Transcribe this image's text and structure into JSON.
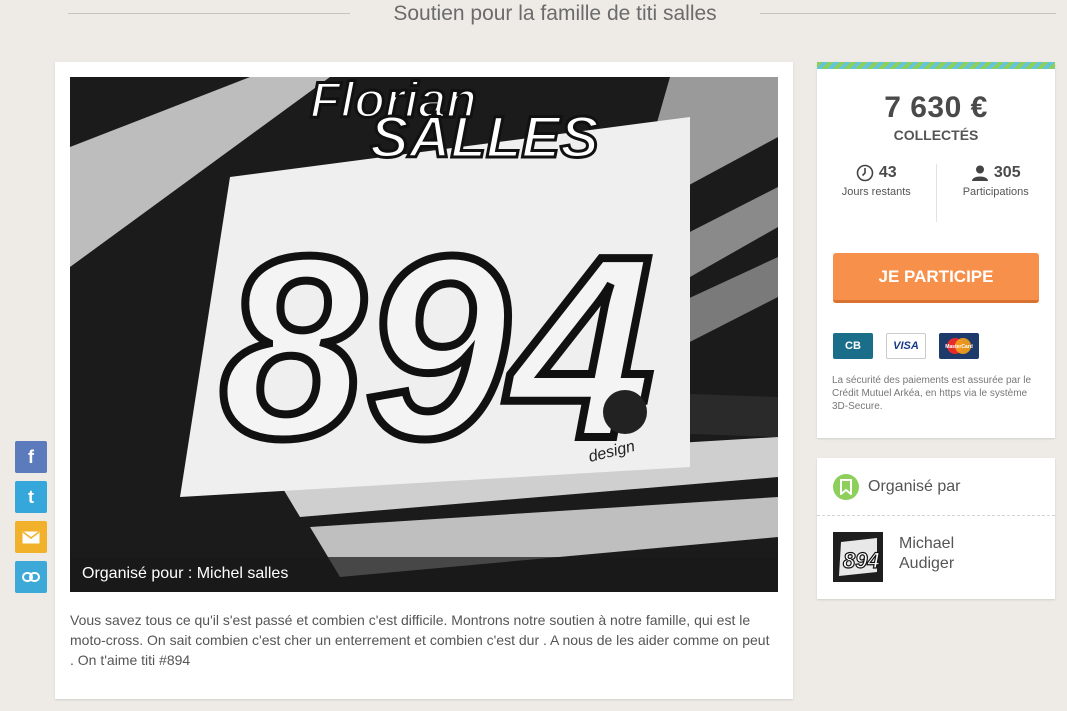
{
  "page": {
    "title": "Soutien pour la famille de titi salles"
  },
  "photo": {
    "caption": "Organisé pour : Michel salles",
    "jersey_name_1": "Florian",
    "jersey_name_2": "SALLES",
    "jersey_number": "894",
    "jersey_brand": "design"
  },
  "description": "Vous savez tous ce qu'il s'est passé et combien c'est difficile.  Montrons notre soutien à notre famille, qui est le moto-cross. On sait combien c'est cher un enterrement et combien c'est dur . A nous de les aider comme on peut . On t'aime titi #894",
  "stats": {
    "amount": "7 630 €",
    "collected_label": "COLLECTÉS",
    "days_left": "43",
    "days_left_label": "Jours restants",
    "participations": "305",
    "participations_label": "Participations",
    "cta_label": "JE PARTICIPE",
    "security_text": "La sécurité des paiements est assurée par le Crédit Mutuel Arkéa, en https via le système 3D-Secure.",
    "card_logos": {
      "cb": "CB",
      "visa": "VISA",
      "mastercard": "MasterCard"
    }
  },
  "organizer": {
    "heading": "Organisé par",
    "first_name": "Michael",
    "last_name": "Audiger"
  },
  "social": {
    "facebook": "f",
    "twitter": "t"
  },
  "colors": {
    "accent_orange": "#f7904a",
    "accent_green": "#8ccf5a",
    "accent_blue": "#64c4d8"
  }
}
